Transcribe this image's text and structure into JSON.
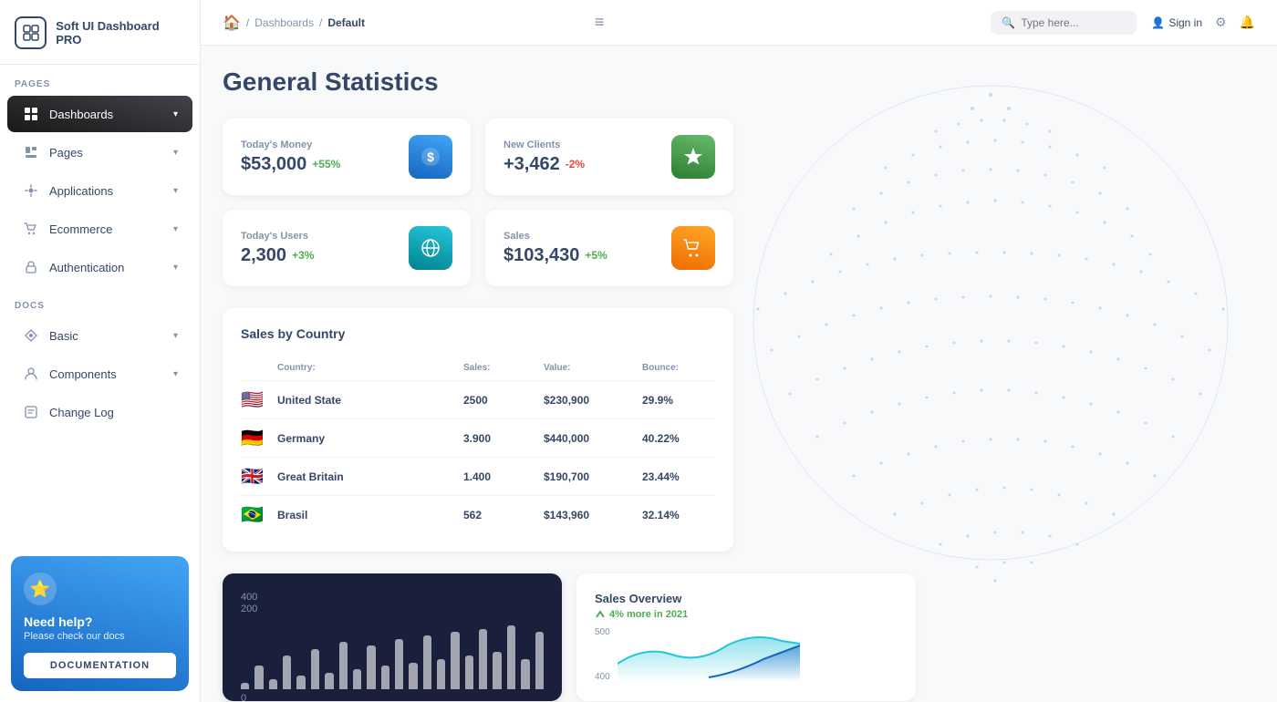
{
  "app": {
    "name": "Soft UI Dashboard PRO",
    "logo_symbol": "⊞"
  },
  "sidebar": {
    "section_pages": "PAGES",
    "section_docs": "DOCS",
    "items_pages": [
      {
        "id": "dashboards",
        "label": "Dashboards",
        "icon": "📊",
        "active": true,
        "has_arrow": true
      },
      {
        "id": "pages",
        "label": "Pages",
        "icon": "📋",
        "active": false,
        "has_arrow": true
      },
      {
        "id": "applications",
        "label": "Applications",
        "icon": "🔧",
        "active": false,
        "has_arrow": true
      },
      {
        "id": "ecommerce",
        "label": "Ecommerce",
        "icon": "🛒",
        "active": false,
        "has_arrow": true
      },
      {
        "id": "authentication",
        "label": "Authentication",
        "icon": "🔐",
        "active": false,
        "has_arrow": true
      }
    ],
    "items_docs": [
      {
        "id": "basic",
        "label": "Basic",
        "icon": "🚀",
        "has_arrow": true
      },
      {
        "id": "components",
        "label": "Components",
        "icon": "👤",
        "has_arrow": true
      },
      {
        "id": "changelog",
        "label": "Change Log",
        "icon": "📄",
        "has_arrow": false
      }
    ],
    "help": {
      "star": "⭐",
      "title": "Need help?",
      "subtitle": "Please check our docs",
      "button_label": "DOCUMENTATION"
    }
  },
  "topbar": {
    "home_icon": "🏠",
    "breadcrumb_sep": "/",
    "breadcrumb_dashboards": "Dashboards",
    "breadcrumb_current": "Default",
    "page_title": "Default",
    "hamburger": "≡",
    "search_placeholder": "Type here...",
    "signin_label": "Sign in",
    "settings_icon": "⚙",
    "notifications_icon": "🔔"
  },
  "page": {
    "title": "General Statistics"
  },
  "stats": [
    {
      "id": "money",
      "label": "Today's Money",
      "value": "$53,000",
      "change": "+55%",
      "change_type": "positive",
      "icon": "$",
      "icon_color": "blue"
    },
    {
      "id": "clients",
      "label": "New Clients",
      "value": "+3,462",
      "change": "-2%",
      "change_type": "negative",
      "icon": "🏆",
      "icon_color": "green"
    },
    {
      "id": "users",
      "label": "Today's Users",
      "value": "2,300",
      "change": "+3%",
      "change_type": "positive",
      "icon": "🌐",
      "icon_color": "cyan"
    },
    {
      "id": "sales",
      "label": "Sales",
      "value": "$103,430",
      "change": "+5%",
      "change_type": "positive",
      "icon": "🛒",
      "icon_color": "orange"
    }
  ],
  "sales_country": {
    "title": "Sales by Country",
    "headers": {
      "country": "Country:",
      "sales": "Sales:",
      "value": "Value:",
      "bounce": "Bounce:"
    },
    "rows": [
      {
        "flag": "🇺🇸",
        "country": "United State",
        "sales": "2500",
        "value": "$230,900",
        "bounce": "29.9%"
      },
      {
        "flag": "🇩🇪",
        "country": "Germany",
        "sales": "3.900",
        "value": "$440,000",
        "bounce": "40.22%"
      },
      {
        "flag": "🇬🇧",
        "country": "Great Britain",
        "sales": "1.400",
        "value": "$190,700",
        "bounce": "23.44%"
      },
      {
        "flag": "🇧🇷",
        "country": "Brasil",
        "sales": "562",
        "value": "$143,960",
        "bounce": "32.14%"
      }
    ]
  },
  "bar_chart": {
    "title": "",
    "y_labels": [
      "400",
      "200",
      "0"
    ],
    "bars": [
      10,
      35,
      15,
      50,
      20,
      60,
      25,
      70,
      30,
      65,
      35,
      75,
      40,
      80,
      45,
      85,
      50,
      90,
      55,
      95,
      45,
      85
    ]
  },
  "sales_overview": {
    "title": "Sales Overview",
    "sub": "4% more in 2021",
    "y_labels": [
      "500",
      "400"
    ]
  },
  "colors": {
    "accent_blue": "#1565c0",
    "sidebar_active_bg": "#191919",
    "positive": "#4caf50",
    "negative": "#f44336"
  }
}
